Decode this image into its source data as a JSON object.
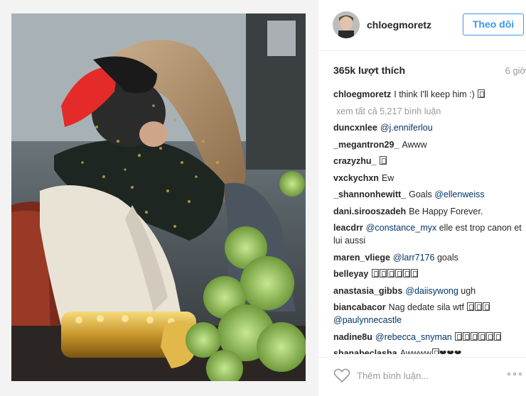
{
  "post": {
    "username": "chloegmoretz",
    "follow_label": "Theo dõi",
    "likes": "365k lượt thích",
    "time": "6 giờ",
    "view_all": "xem tất cả 5,217 bình luận",
    "comment_placeholder": "Thêm bình luận..."
  },
  "caption": {
    "user": "chloegmoretz",
    "text": "I think I'll keep him :)"
  },
  "comments": [
    {
      "user": "duncxnlee",
      "mention": "@j.enniferlou",
      "text": ""
    },
    {
      "user": "_megantron29_",
      "text": "Awww"
    },
    {
      "user": "crazyzhu_",
      "text": ""
    },
    {
      "user": "vxckychxn",
      "text": "Ew"
    },
    {
      "user": "_shannonhewitt_",
      "text": "Goals",
      "mention": "@ellenweiss"
    },
    {
      "user": "dani.sirooszadeh",
      "text": "Be Happy Forever."
    },
    {
      "user": "leacdrr",
      "mention": "@constance_myx",
      "text": "elle est trop canon et lui aussi"
    },
    {
      "user": "maren_vliege",
      "mention": "@larr7176",
      "text": "goals"
    },
    {
      "user": "belleyay",
      "text": ""
    },
    {
      "user": "anastasia_gibbs",
      "mention": "@daiisywong",
      "text": "ugh"
    },
    {
      "user": "biancabacor",
      "text": "Nag dedate sila wtf",
      "mention2": "@paulynnecastle"
    },
    {
      "user": "nadine8u",
      "mention": "@rebecca_snyman",
      "text": ""
    },
    {
      "user": "shanabeclasha",
      "text": "Awwww"
    }
  ],
  "colors": {
    "link": "#003569",
    "button": "#3897f0",
    "muted": "#999999"
  },
  "icons": {
    "like": "heart-outline-icon",
    "more": "ellipsis-icon"
  }
}
